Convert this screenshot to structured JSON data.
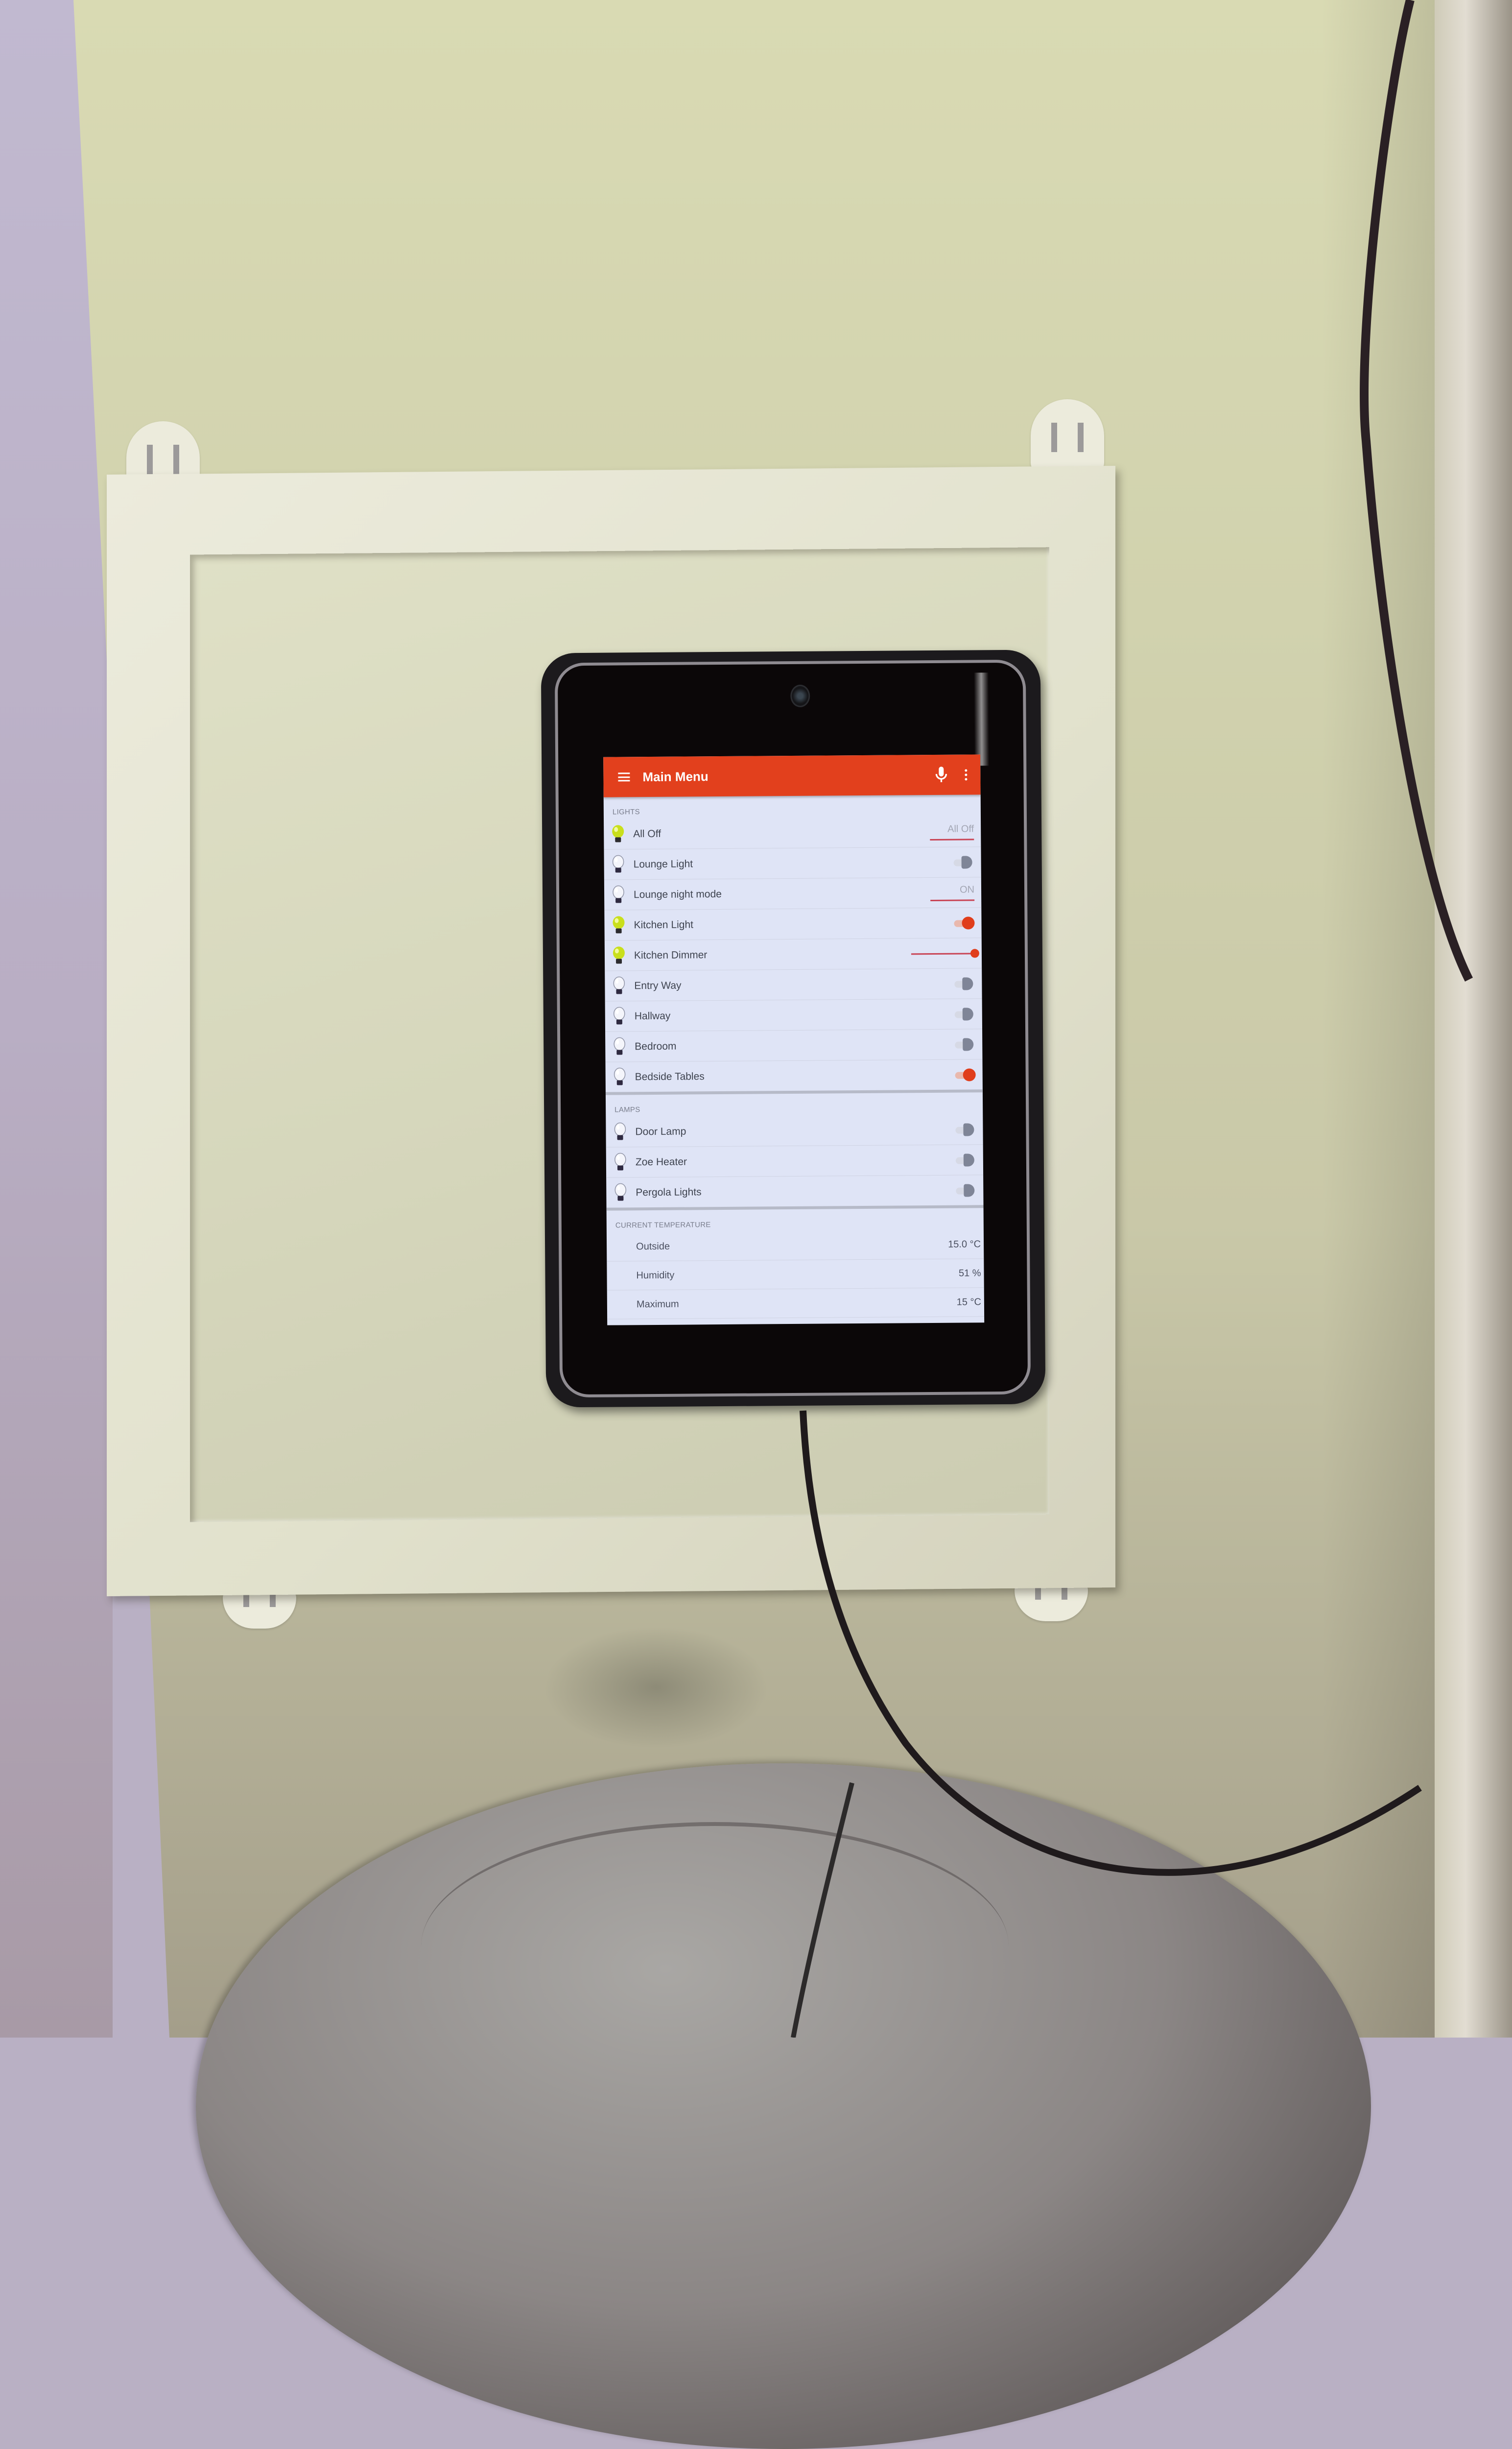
{
  "app": {
    "title": "Main Menu",
    "accent_color": "#e2401d",
    "icons": {
      "menu": "hamburger-menu-icon",
      "voice": "microphone-icon",
      "overflow": "more-vert-icon"
    }
  },
  "sections": [
    {
      "id": "lights",
      "header": "LIGHTS",
      "items": [
        {
          "label": "All Off",
          "icon": "bulb-on-icon",
          "control": "selector",
          "value": "All Off",
          "state": "on"
        },
        {
          "label": "Lounge Light",
          "icon": "bulb-off-icon",
          "control": "switch",
          "state": "off"
        },
        {
          "label": "Lounge night mode",
          "icon": "bulb-off-icon",
          "control": "selector",
          "value": "ON",
          "state": "off"
        },
        {
          "label": "Kitchen Light",
          "icon": "bulb-on-icon",
          "control": "switch",
          "state": "on"
        },
        {
          "label": "Kitchen Dimmer",
          "icon": "bulb-on-icon",
          "control": "slider",
          "level": 1.0,
          "state": "on"
        },
        {
          "label": "Entry Way",
          "icon": "bulb-off-icon",
          "control": "switch",
          "state": "off"
        },
        {
          "label": "Hallway",
          "icon": "bulb-off-icon",
          "control": "switch",
          "state": "off"
        },
        {
          "label": "Bedroom",
          "icon": "bulb-off-icon",
          "control": "switch",
          "state": "off"
        },
        {
          "label": "Bedside Tables",
          "icon": "bulb-off-icon",
          "control": "switch",
          "state": "on"
        }
      ]
    },
    {
      "id": "lamps",
      "header": "LAMPS",
      "items": [
        {
          "label": "Door Lamp",
          "icon": "bulb-off-icon",
          "control": "switch",
          "state": "off"
        },
        {
          "label": "Zoe Heater",
          "icon": "bulb-off-icon",
          "control": "switch",
          "state": "off"
        },
        {
          "label": "Pergola Lights",
          "icon": "bulb-off-icon",
          "control": "switch",
          "state": "off"
        }
      ]
    }
  ],
  "temperature": {
    "header": "CURRENT TEMPERATURE",
    "items": [
      {
        "label": "Outside",
        "value": "15.0 °C"
      },
      {
        "label": "Humidity",
        "value": "51 %"
      },
      {
        "label": "Maximum",
        "value": "15 °C"
      }
    ]
  }
}
